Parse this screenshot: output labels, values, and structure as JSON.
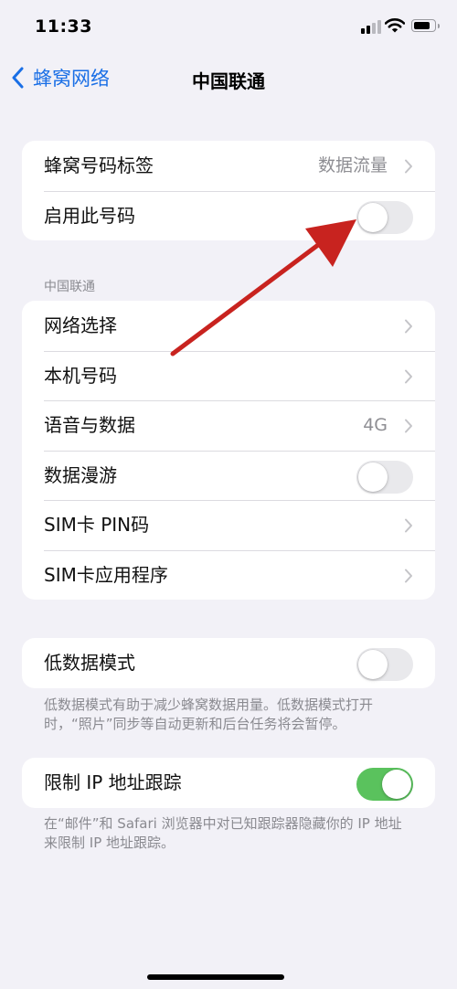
{
  "status_bar": {
    "time": "11:33"
  },
  "nav": {
    "back_label": "蜂窝网络",
    "title": "中国联通"
  },
  "group1": {
    "rows": [
      {
        "label": "蜂窝号码标签",
        "value": "数据流量"
      },
      {
        "label": "启用此号码",
        "toggle_on": false
      }
    ]
  },
  "section2": {
    "header": "中国联通",
    "rows": [
      {
        "label": "网络选择"
      },
      {
        "label": "本机号码"
      },
      {
        "label": "语音与数据",
        "value": "4G"
      },
      {
        "label": "数据漫游",
        "toggle_on": false
      },
      {
        "label": "SIM卡 PIN码"
      },
      {
        "label": "SIM卡应用程序"
      }
    ]
  },
  "group3": {
    "rows": [
      {
        "label": "低数据模式",
        "toggle_on": false
      }
    ],
    "footer_lines": [
      "低数据模式有助于减少蜂窝数据用量。低数据模式打开",
      "时，“照片”同步等自动更新和后台任务将会暂停。"
    ]
  },
  "group4": {
    "rows": [
      {
        "label": "限制 IP 地址跟踪",
        "toggle_on": true
      }
    ],
    "footer_lines": [
      "在“邮件”和 Safari 浏览器中对已知跟踪器隐藏你的 IP 地址",
      "来限制 IP 地址跟踪。"
    ]
  },
  "colors": {
    "accent": "#1a6fe6",
    "toggle_on": "#5ac25d",
    "annotation_arrow": "#c8231f"
  },
  "icons": [
    "back-chevron-icon",
    "chevron-right-icon",
    "cellular-signal-icon",
    "wifi-icon",
    "battery-icon",
    "annotation-arrow"
  ]
}
